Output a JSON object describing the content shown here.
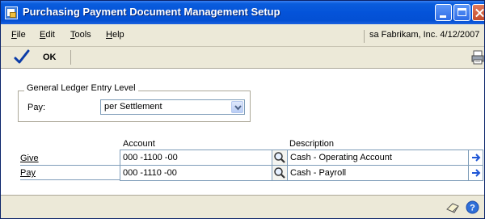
{
  "window": {
    "title": "Purchasing Payment Document Management Setup",
    "buttons": [
      "minimize",
      "maximize",
      "close"
    ]
  },
  "menu": {
    "items": [
      {
        "label": "File",
        "underline": "F",
        "rest": "ile"
      },
      {
        "label": "Edit",
        "underline": "E",
        "rest": "dit"
      },
      {
        "label": "Tools",
        "underline": "T",
        "rest": "ools"
      },
      {
        "label": "Help",
        "underline": "H",
        "rest": "elp"
      }
    ],
    "status": "sa  Fabrikam, Inc.  4/12/2007"
  },
  "toolbar": {
    "ok_label": "OK",
    "ok_icon": "checkmark-icon",
    "print_icon": "printer-icon"
  },
  "group": {
    "title": "General Ledger Entry Level",
    "pay_label": "Pay:",
    "pay_value": "per Settlement"
  },
  "grid": {
    "headers": {
      "account": "Account",
      "description": "Description"
    },
    "rows": [
      {
        "label": "Give",
        "account": "000 -1100 -00",
        "description": "Cash - Operating Account"
      },
      {
        "label": "Pay",
        "account": "000 -1110 -00",
        "description": "Cash - Payroll"
      }
    ]
  },
  "footer": {
    "note_icon": "note-icon",
    "help_icon": "help-icon"
  },
  "colors": {
    "titlebar": "#0453d9",
    "window_bg": "#ece9d8",
    "field_border": "#7f9db9",
    "arrow": "#1f56d6"
  }
}
